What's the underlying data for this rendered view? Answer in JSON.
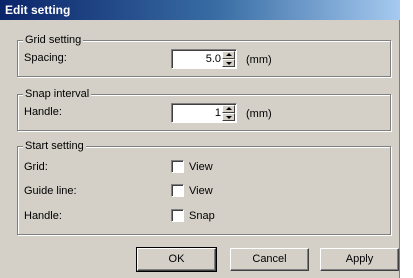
{
  "window": {
    "title": "Edit setting"
  },
  "grid_setting": {
    "title": "Grid setting",
    "spacing_label": "Spacing:",
    "spacing_value": "5.0",
    "unit": "(mm)"
  },
  "snap_interval": {
    "title": "Snap interval",
    "handle_label": "Handle:",
    "handle_value": "1",
    "unit": "(mm)"
  },
  "start_setting": {
    "title": "Start setting",
    "rows": [
      {
        "label": "Grid:",
        "option": "View",
        "checked": false
      },
      {
        "label": "Guide line:",
        "option": "View",
        "checked": false
      },
      {
        "label": "Handle:",
        "option": "Snap",
        "checked": false
      }
    ]
  },
  "buttons": {
    "ok": "OK",
    "cancel": "Cancel",
    "apply": "Apply"
  },
  "colors": {
    "face": "#d4d0c8",
    "title_start": "#0a246a",
    "title_end": "#a6caf0"
  }
}
